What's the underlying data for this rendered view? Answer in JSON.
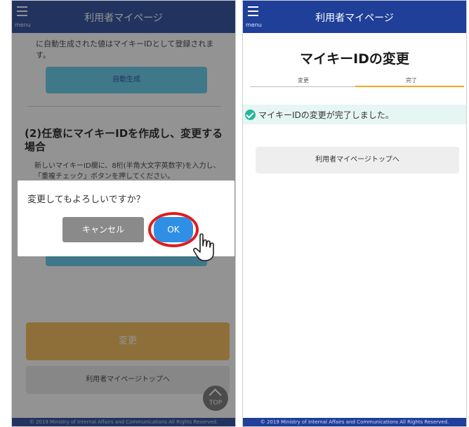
{
  "left_screen": {
    "header": {
      "menu_label": "menu",
      "title": "利用者マイページ"
    },
    "intro_text": "に自動生成された値はマイキーIDとして登録されます。",
    "autogen_button_label": "自動生成",
    "section_heading": "(2)任意にマイキーIDを作成し、変更する場合",
    "section_desc": "新しいマイキーID欄に、8桁(半角大文字英数字)を入力し、「重複チェック」ボタンを押してください。",
    "change_button_label": "変更",
    "mypage_top_button_label": "利用者マイページトップへ",
    "top_button_label": "TOP",
    "footer": "© 2019 Ministry of Internal Affairs and Communications All Rights Reserved.",
    "dialog": {
      "message": "変更してもよろしいですか？",
      "cancel_label": "キャンセル",
      "ok_label": "OK"
    }
  },
  "right_screen": {
    "header": {
      "menu_label": "menu",
      "title": "利用者マイページ"
    },
    "page_title": "マイキーIDの変更",
    "steps": [
      "変更",
      "完了"
    ],
    "current_step": "完了",
    "done_message": "マイキーIDの変更が完了しました。",
    "mypage_top_button_label": "利用者マイページトップへ",
    "footer": "© 2019 Ministry of Internal Affairs and Communications All Rights Reserved."
  },
  "colors": {
    "header_blue": "#1f3f98",
    "autogen_cyan": "#56c9ea",
    "change_orange": "#f5b74c",
    "ok_blue": "#2f8fe4",
    "highlight_red": "#e21b1b",
    "success_green": "#25b89a",
    "progress_orange": "#f5a623"
  },
  "icons": [
    "menu-icon",
    "chevron-up-icon",
    "pointing-hand-icon",
    "check-circle-icon"
  ]
}
